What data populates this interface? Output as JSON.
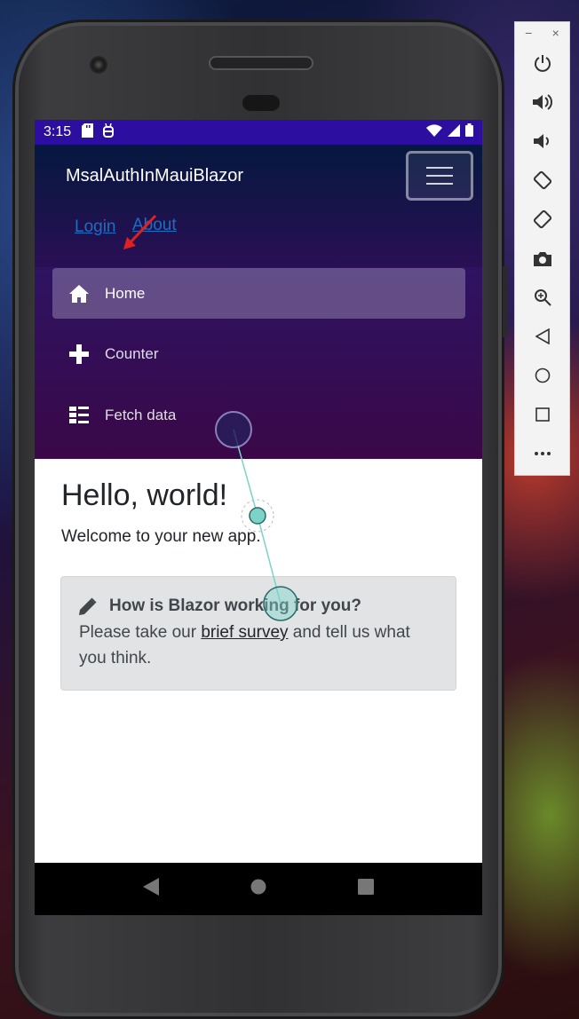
{
  "status_bar": {
    "time": "3:15",
    "left_icons": [
      "sd-card-icon",
      "android-debug-icon"
    ],
    "right_icons": [
      "wifi-icon",
      "signal-icon",
      "battery-icon"
    ]
  },
  "header": {
    "app_title": "MsalAuthInMauiBlazor",
    "menu_icon": "hamburger-icon",
    "links": [
      {
        "label": "Login"
      },
      {
        "label": "About"
      }
    ]
  },
  "nav_menu": {
    "items": [
      {
        "label": "Home",
        "icon": "home-icon",
        "active": true
      },
      {
        "label": "Counter",
        "icon": "plus-icon",
        "active": false
      },
      {
        "label": "Fetch data",
        "icon": "list-icon",
        "active": false
      }
    ]
  },
  "main": {
    "heading": "Hello, world!",
    "welcome": "Welcome to your new app.",
    "survey": {
      "icon": "pencil-icon",
      "title": "How is Blazor working for you?",
      "text_before": "Please take our ",
      "link_text": "brief survey",
      "text_after": " and tell us what you think."
    }
  },
  "system_nav": {
    "buttons": [
      "back-icon",
      "home-circle-icon",
      "recents-icon"
    ]
  },
  "emulator_toolbar": {
    "window_controls": [
      "−",
      "×"
    ],
    "buttons": [
      "power-icon",
      "volume-up-icon",
      "volume-down-icon",
      "rotate-left-icon",
      "rotate-right-icon",
      "camera-icon",
      "zoom-icon",
      "back-icon",
      "home-icon",
      "overview-icon",
      "more-icon"
    ]
  },
  "colors": {
    "status_bar": "#2c0fa0",
    "link": "#1b6ec2",
    "nav_top": "#2e1362",
    "nav_bottom": "#3a0848",
    "survey_bg": "#e2e3e5",
    "touch_marker": "#7dd3c8"
  }
}
